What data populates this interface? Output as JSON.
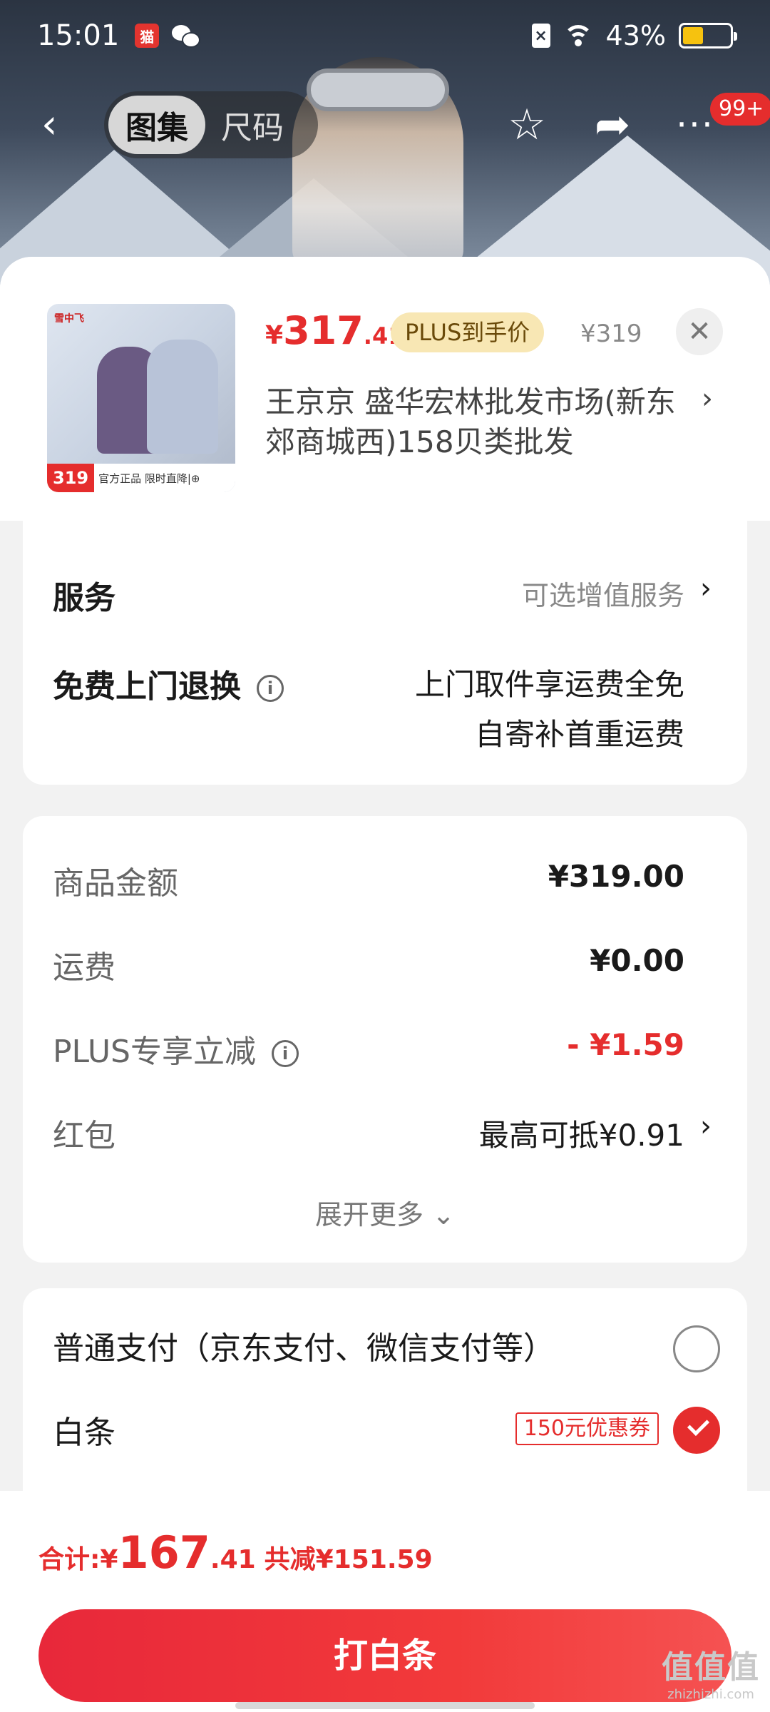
{
  "status": {
    "time": "15:01",
    "battery": "43%",
    "battery_level": 0.43,
    "app_icon_text": "猫",
    "sim_icon_text": "×"
  },
  "nav": {
    "tabs": [
      {
        "label": "图集",
        "active": true
      },
      {
        "label": "尺码",
        "active": false
      }
    ],
    "notification_count": "99+"
  },
  "product": {
    "price_symbol": "¥",
    "price_int": "317",
    "price_dec": ".41",
    "plus_tag": "PLUS到手价",
    "original_price": "¥319",
    "seller": "王京京  盛华宏林批发市场(新东郊商城西)158贝类批发",
    "thumb": {
      "brand": "雪中飞",
      "price": "319",
      "tag": "官方正品  限时直降|⊕"
    }
  },
  "services": {
    "label": "服务",
    "value": "可选增值服务",
    "return_label": "免费上门退换",
    "return_line1": "上门取件享运费全免",
    "return_line2": "自寄补首重运费"
  },
  "summary": {
    "rows": [
      {
        "label": "商品金额",
        "value": "¥319.00"
      },
      {
        "label": "运费",
        "value": "¥0.00"
      },
      {
        "label": "PLUS专享立减",
        "value": "- ¥1.59"
      },
      {
        "label": "红包",
        "value": "最高可抵¥0.91"
      }
    ],
    "expand": "展开更多 ⌄"
  },
  "payment": {
    "normal_label": "普通支付（京东支付、微信支付等）",
    "baitiao_label": "白条",
    "coupon": "150元优惠券",
    "selected": "白条"
  },
  "bottom": {
    "total_label": "合计: ",
    "total_symbol": "¥",
    "total_int": "167",
    "total_dec": ".41",
    "saving": "共减¥151.59",
    "pay_button": "打白条"
  },
  "watermark": {
    "line1": "值值值",
    "line2": "zhizhizhi.com"
  },
  "colors": {
    "accent": "#e52d2d",
    "plus_bg": "#f8e7b4",
    "battery": "#f6c20f"
  }
}
